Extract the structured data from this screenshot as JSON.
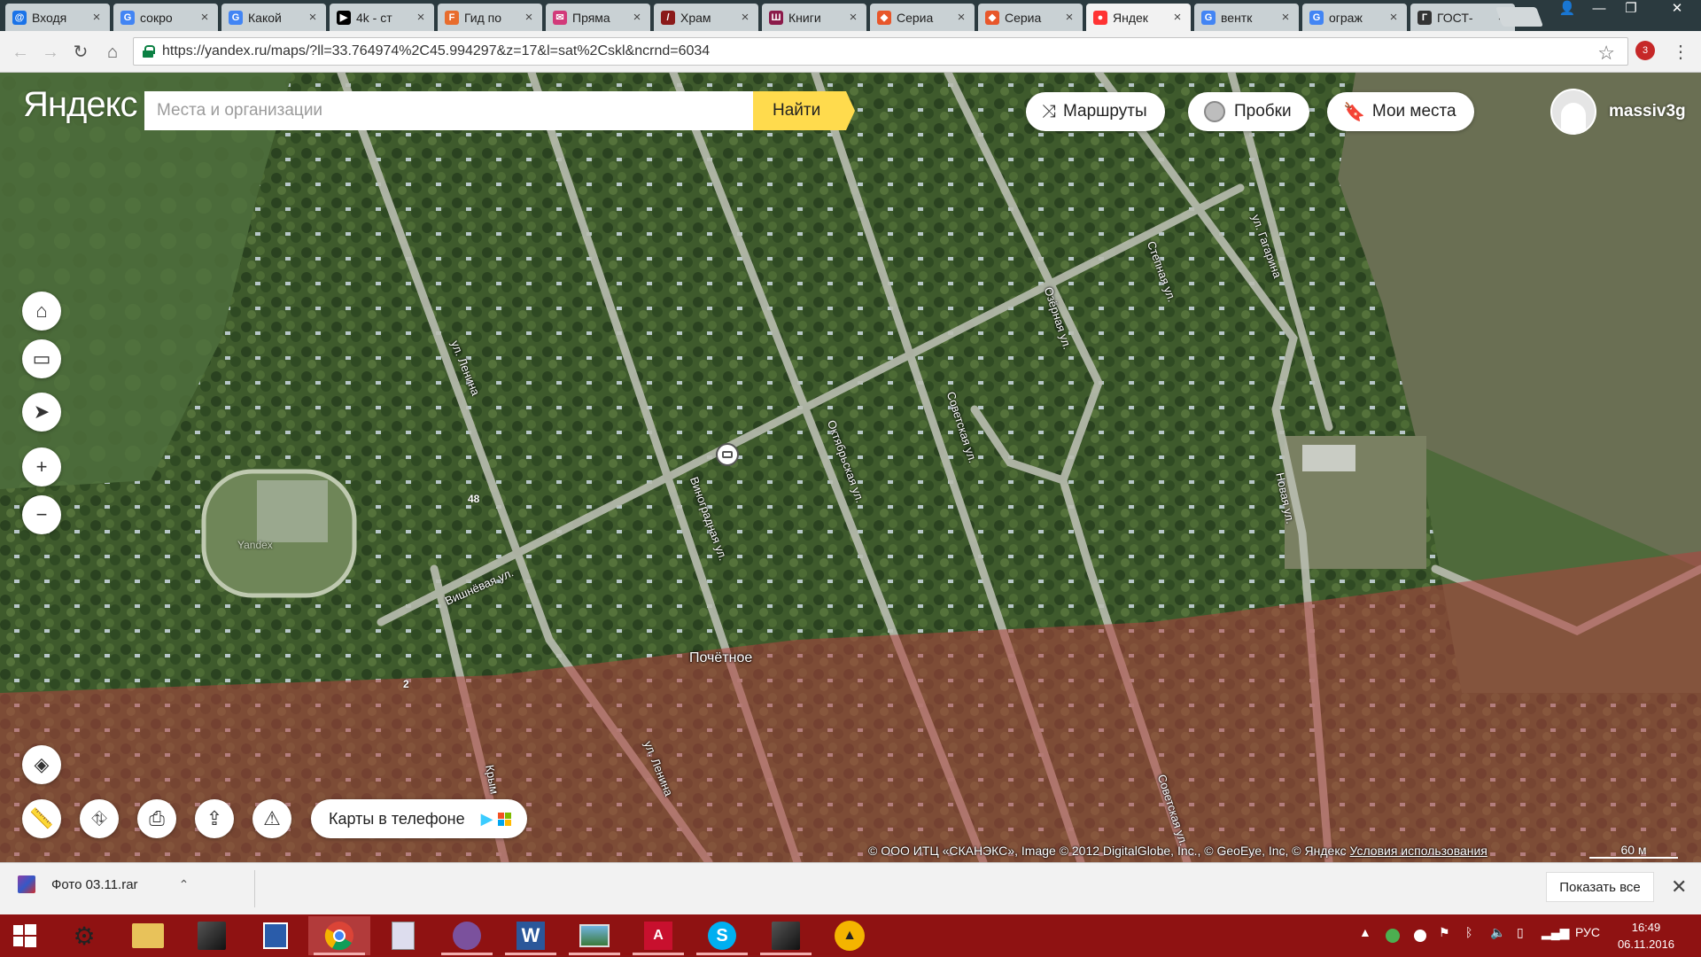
{
  "browser": {
    "tabs": [
      {
        "title": "Входя",
        "fav_color": "#1a73e8",
        "fav_glyph": "@"
      },
      {
        "title": "сокро",
        "fav_color": "#4285f4",
        "fav_glyph": "G"
      },
      {
        "title": "Какой",
        "fav_color": "#4285f4",
        "fav_glyph": "G"
      },
      {
        "title": "4k - ст",
        "fav_color": "#000000",
        "fav_glyph": "▶"
      },
      {
        "title": "Гид по",
        "fav_color": "#e86c2c",
        "fav_glyph": "F"
      },
      {
        "title": "Пряма",
        "fav_color": "#d23a7a",
        "fav_glyph": "✉"
      },
      {
        "title": "Храм",
        "fav_color": "#8b1a1a",
        "fav_glyph": "/"
      },
      {
        "title": "Книги",
        "fav_color": "#8b1a4a",
        "fav_glyph": "Ш"
      },
      {
        "title": "Сериа",
        "fav_color": "#e8562a",
        "fav_glyph": "◆"
      },
      {
        "title": "Сериа",
        "fav_color": "#e8562a",
        "fav_glyph": "◆"
      },
      {
        "title": "Яндек",
        "fav_color": "#ff3333",
        "fav_glyph": "●",
        "active": true
      },
      {
        "title": "вентк",
        "fav_color": "#4285f4",
        "fav_glyph": "G"
      },
      {
        "title": "ограж",
        "fav_color": "#4285f4",
        "fav_glyph": "G"
      },
      {
        "title": "ГОСТ-",
        "fav_color": "#333333",
        "fav_glyph": "Г"
      }
    ],
    "url": "https://yandex.ru/maps/?ll=33.764974%2C45.994297&z=17&l=sat%2Cskl&ncrnd=6034",
    "extension_badge": "3"
  },
  "map": {
    "logo": "Яндекс",
    "search_placeholder": "Места и организации",
    "search_button": "Найти",
    "routes_label": "Маршруты",
    "traffic_label": "Пробки",
    "places_label": "Мои места",
    "username": "massiv3g",
    "phone_label": "Карты в телефоне",
    "copyright": "© ООО ИТЦ «СКАНЭКС», Image © 2012 DigitalGlobe, Inc., © GeoEye, Inc, © Яндекс",
    "terms_link": "Условия использования",
    "scale": "60 м",
    "streets": {
      "lenina_top": "ул. Ленина",
      "lenina_bottom": "ул. Ленина",
      "vinogradnaya": "Виноградная ул.",
      "oktyabrskaya": "Октябрьская ул.",
      "sovetskaya_top": "Советская ул.",
      "sovetskaya_bottom": "Советская ул.",
      "ozernaya": "Озёрная ул.",
      "stepnaya": "Степная ул.",
      "gagarina": "ул. Гагарина",
      "novaya": "Новая ул.",
      "vishnevaya": "Вишнёвая ул.",
      "krym": "Крым"
    },
    "place_name": "Почётное",
    "house_48": "48",
    "house_2": "2",
    "watermark": "Yandex"
  },
  "downloads": {
    "file_name": "Фото 03.11.rar",
    "show_all": "Показать все"
  },
  "taskbar": {
    "lang": "РУС",
    "time": "16:49",
    "date": "06.11.2016"
  }
}
